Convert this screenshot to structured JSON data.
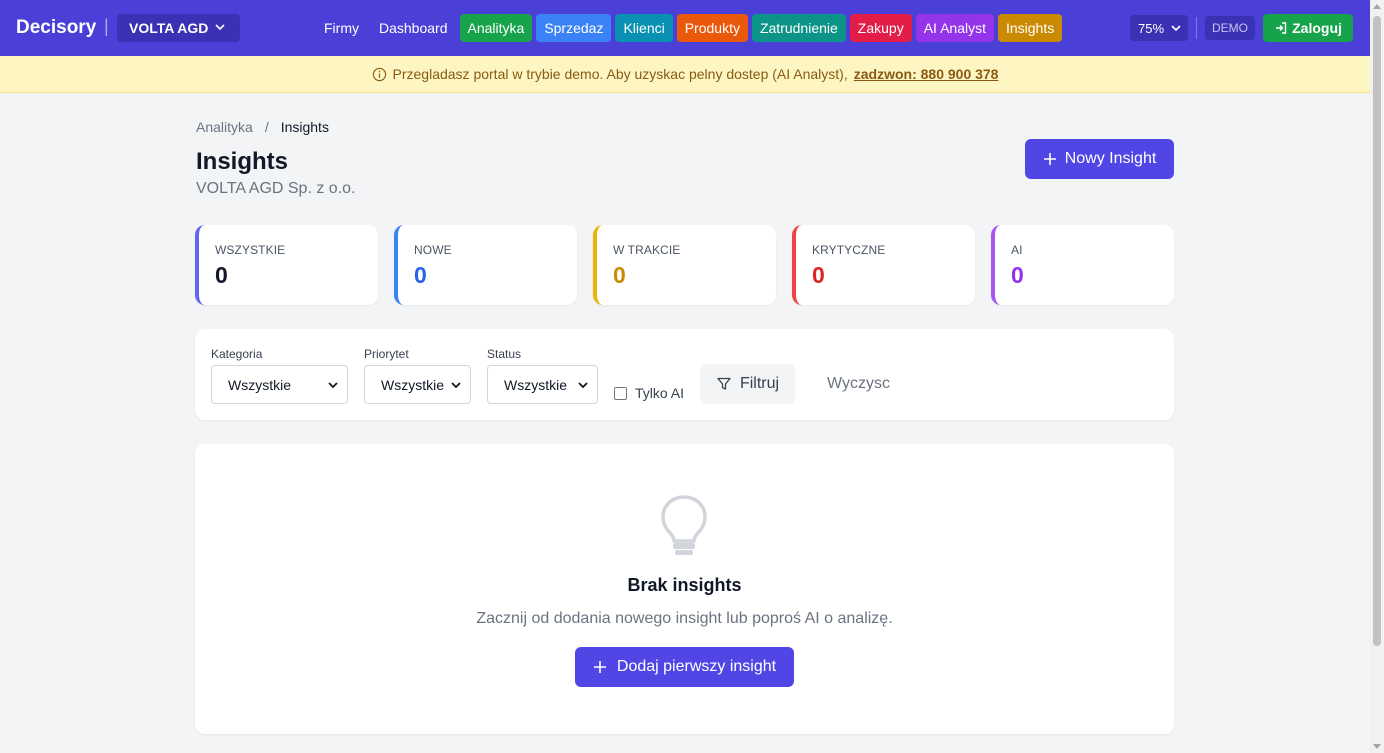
{
  "app": {
    "brand": "Decisory",
    "company": "VOLTA AGD"
  },
  "nav": {
    "items": [
      {
        "label": "Firmy",
        "color": ""
      },
      {
        "label": "Dashboard",
        "color": ""
      },
      {
        "label": "Analityka",
        "color": "#16a34a"
      },
      {
        "label": "Sprzedaz",
        "color": "#3b82f6"
      },
      {
        "label": "Klienci",
        "color": "#0891b2"
      },
      {
        "label": "Produkty",
        "color": "#ea580c"
      },
      {
        "label": "Zatrudnienie",
        "color": "#0d9488"
      },
      {
        "label": "Zakupy",
        "color": "#e11d48"
      },
      {
        "label": "AI Analyst",
        "color": "#9333ea"
      },
      {
        "label": "Insights",
        "color": "#ca8a04"
      }
    ],
    "zoom": "75%",
    "demo_badge": "DEMO",
    "login_label": "Zaloguj"
  },
  "banner": {
    "text": "Przegladasz portal w trybie demo. Aby uzyskac pelny dostep (AI Analyst),",
    "link": "zadzwon: 880 900 378"
  },
  "breadcrumb": {
    "parent": "Analityka",
    "separator": "/",
    "current": "Insights"
  },
  "header": {
    "title": "Insights",
    "subtitle": "VOLTA AGD Sp. z o.o.",
    "new_button": "Nowy Insight"
  },
  "stats": [
    {
      "label": "WSZYSTKIE",
      "value": "0",
      "color": "#111827",
      "accent": "#6366f1"
    },
    {
      "label": "NOWE",
      "value": "0",
      "color": "#2563eb",
      "accent": "#3b82f6"
    },
    {
      "label": "W TRAKCIE",
      "value": "0",
      "color": "#ca8a04",
      "accent": "#eab308"
    },
    {
      "label": "KRYTYCZNE",
      "value": "0",
      "color": "#dc2626",
      "accent": "#ef4444"
    },
    {
      "label": "AI",
      "value": "0",
      "color": "#9333ea",
      "accent": "#a855f7"
    }
  ],
  "filters": {
    "category": {
      "label": "Kategoria",
      "value": "Wszystkie"
    },
    "priority": {
      "label": "Priorytet",
      "value": "Wszystkie"
    },
    "status": {
      "label": "Status",
      "value": "Wszystkie"
    },
    "ai_only_label": "Tylko AI",
    "filter_button": "Filtruj",
    "clear_label": "Wyczysc"
  },
  "empty": {
    "title": "Brak insights",
    "description": "Zacznij od dodania nowego insight lub poproś AI o analizę.",
    "button": "Dodaj pierwszy insight"
  }
}
